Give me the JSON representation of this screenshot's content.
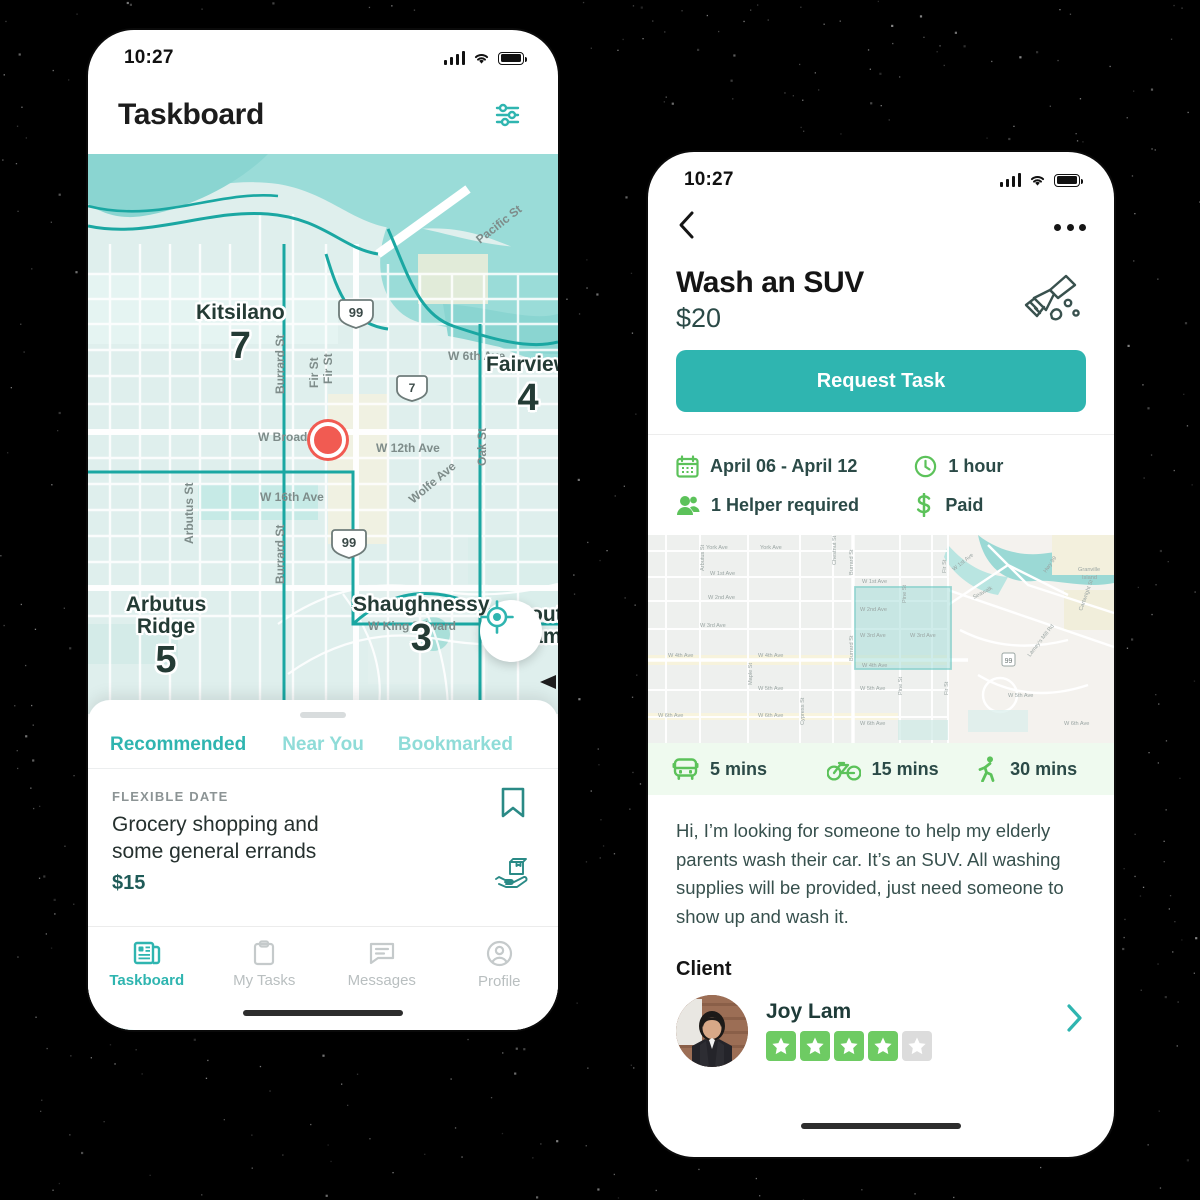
{
  "background": {
    "color": "#000000"
  },
  "theme": {
    "teal": "#2FB5B0",
    "teal_light": "#8fdcd8",
    "green": "#6ECB63",
    "dark": "#2b4a47",
    "red_pin": "#F15B52"
  },
  "left_phone": {
    "status_bar": {
      "time": "10:27",
      "signal_icon": "cellular-bars-icon",
      "wifi_icon": "wifi-icon",
      "battery_icon": "battery-full-icon"
    },
    "header": {
      "title": "Taskboard",
      "filter_icon": "sliders-filter-icon"
    },
    "map": {
      "locate_icon": "crosshair-locate-icon",
      "pin_icon": "location-pin-icon",
      "neighborhoods": [
        {
          "name": "Kitsilano",
          "count": "7"
        },
        {
          "name": "Fairview",
          "count": "4"
        },
        {
          "name": "Shaughnessy",
          "count": "3"
        },
        {
          "name": "Arbutus Ridge",
          "count": "5"
        },
        {
          "name": "South Cambie",
          "count": ""
        }
      ],
      "street_labels": [
        "Pacific St",
        "Burrard St",
        "Fir St",
        "W Broadway",
        "W 6th Ave",
        "W 12th Ave",
        "Oak St",
        "W 16th Ave",
        "Arbutus St",
        "Wolfe Ave",
        "W King Edward"
      ],
      "highway_shields": [
        "99",
        "7",
        "99"
      ]
    },
    "sheet": {
      "tabs": [
        {
          "label": "Recommended",
          "active": true
        },
        {
          "label": "Near You",
          "active": false
        },
        {
          "label": "Bookmarked",
          "active": false
        }
      ],
      "task_card": {
        "kicker": "FLEXIBLE DATE",
        "title": "Grocery shopping and some general errands",
        "price": "$15",
        "bookmark_icon": "bookmark-icon",
        "category_icon": "hand-holding-package-icon"
      }
    },
    "tabbar": [
      {
        "label": "Taskboard",
        "icon": "newspaper-icon",
        "active": true
      },
      {
        "label": "My Tasks",
        "icon": "clipboard-icon",
        "active": false
      },
      {
        "label": "Messages",
        "icon": "chat-bubble-icon",
        "active": false
      },
      {
        "label": "Profile",
        "icon": "user-circle-icon",
        "active": false
      }
    ]
  },
  "right_phone": {
    "status_bar": {
      "time": "10:27",
      "signal_icon": "cellular-bars-icon",
      "wifi_icon": "wifi-icon",
      "battery_icon": "battery-full-icon"
    },
    "nav": {
      "back_icon": "chevron-left-icon",
      "more_icon": "more-horizontal-icon"
    },
    "task": {
      "title": "Wash an SUV",
      "price": "$20",
      "category_icon": "brush-bubbles-icon",
      "request_button": "Request Task"
    },
    "meta": [
      {
        "icon": "calendar-icon",
        "label": "April 06 - April 12"
      },
      {
        "icon": "clock-icon",
        "label": "1 hour"
      },
      {
        "icon": "people-icon",
        "label": "1 Helper required"
      },
      {
        "icon": "dollar-icon",
        "label": "Paid"
      }
    ],
    "map": {
      "street_labels": [
        "York Ave",
        "W 1st Ave",
        "W 2nd Ave",
        "W 3rd Ave",
        "W 4th Ave",
        "W 5th Ave",
        "W 6th Ave",
        "Burrard St",
        "Arbutus St",
        "Maple St",
        "Cypress St",
        "Pine St",
        "Fir St",
        "Granville Island",
        "Hwy 99",
        "Lamey's Mill Rd",
        "Cartwright St",
        "Seawalk"
      ],
      "highlight_region": "task-area"
    },
    "transit": [
      {
        "icon": "bus-icon",
        "label": "5 mins"
      },
      {
        "icon": "bicycle-icon",
        "label": "15 mins"
      },
      {
        "icon": "walking-icon",
        "label": "30 mins"
      }
    ],
    "description": "Hi, I’m looking for someone to help my elderly parents wash their car. It’s an SUV. All washing supplies will be provided, just need someone to show up and wash it.",
    "client": {
      "heading": "Client",
      "name": "Joy Lam",
      "avatar_icon": "client-avatar-photo",
      "rating": 4,
      "rating_max": 5,
      "chevron_icon": "chevron-right-icon"
    }
  }
}
